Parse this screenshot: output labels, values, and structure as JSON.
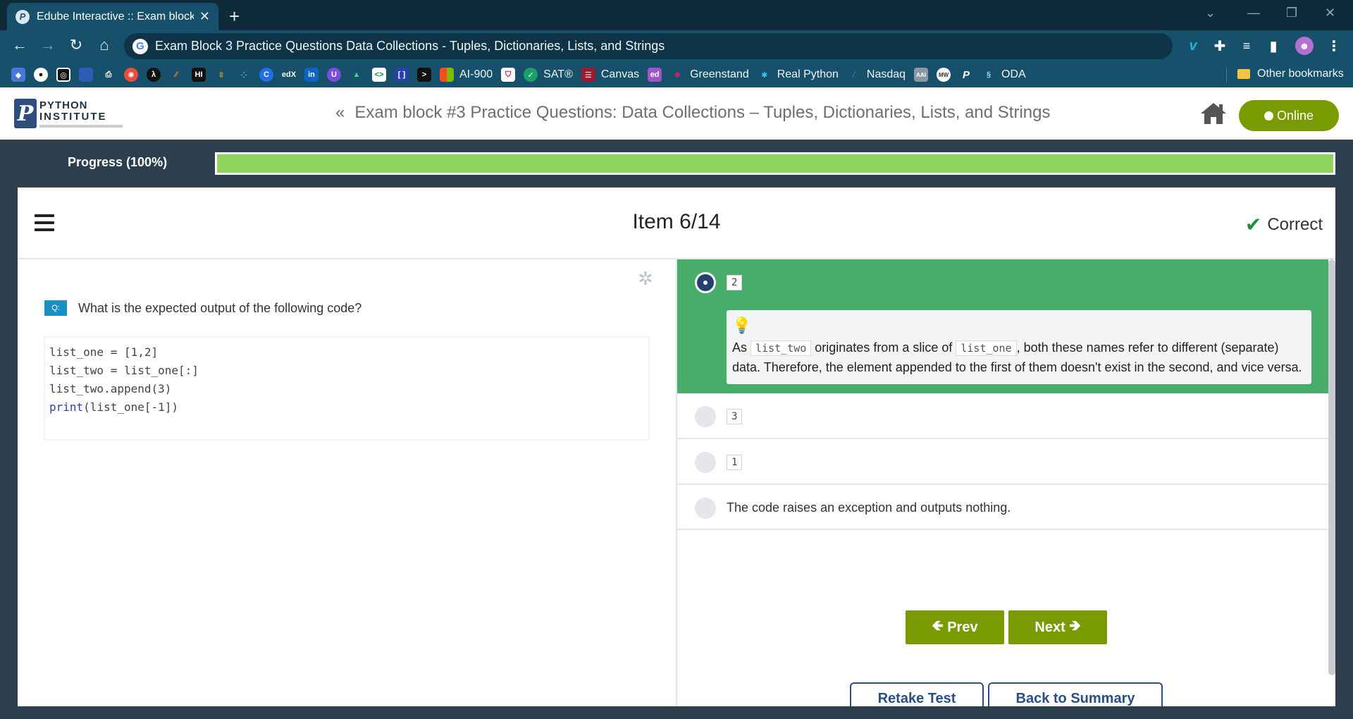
{
  "browser": {
    "tab_title": "Edube Interactive :: Exam block #",
    "tab_favicon": "P",
    "url": "Exam Block 3 Practice Questions Data Collections - Tuples, Dictionaries, Lists, and Strings",
    "bookmarks": [
      "AI-900",
      "SAT®",
      "Canvas",
      "Greenstand",
      "Real Python",
      "Nasdaq",
      "ODA"
    ],
    "other_bookmarks": "Other bookmarks"
  },
  "header": {
    "logo_line1": "PYTHON",
    "logo_line2": "INSTITUTE",
    "chevron": "«",
    "title": "Exam block #3 Practice Questions: Data Collections – Tuples, Dictionaries, Lists, and Strings",
    "online_label": "Online"
  },
  "progress": {
    "label": "Progress (100%)",
    "value": 1.0,
    "fill_color": "#8ed45c"
  },
  "item": {
    "title": "Item 6/14",
    "status": "Correct"
  },
  "question": {
    "badge": "Q:",
    "text": "What is the expected output of the following code?",
    "code": [
      "list_one = [1,2]",
      "list_two = list_one[:]",
      "list_two.append(3)",
      "print(list_one[-1])"
    ]
  },
  "options": [
    {
      "value": "2",
      "selected": true,
      "explanation": {
        "p1": "As ",
        "c1": "list_two",
        "p2": " originates from a slice of ",
        "c2": "list_one",
        "p3": ", both these names refer to different (separate) data. Therefore, the element appended to the first of them doesn't exist in the second, and vice versa."
      }
    },
    {
      "value": "3",
      "selected": false
    },
    {
      "value": "1",
      "selected": false
    },
    {
      "text": "The code raises an exception and outputs nothing.",
      "selected": false
    }
  ],
  "buttons": {
    "prev": "Prev",
    "next": "Next",
    "retake": "Retake Test",
    "summary": "Back to Summary"
  },
  "colors": {
    "accent_green": "#7a9a01",
    "selected_option": "#48ad6a",
    "correct_check": "#1c8f2f"
  }
}
